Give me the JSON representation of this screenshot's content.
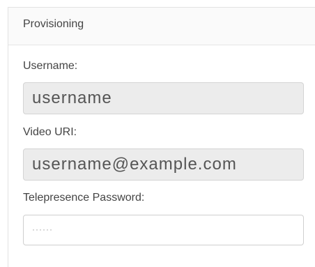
{
  "panel": {
    "title": "Provisioning"
  },
  "fields": {
    "username": {
      "label": "Username:",
      "value": "username"
    },
    "video_uri": {
      "label": "Video URI:",
      "value": "username@example.com"
    },
    "password": {
      "label": "Telepresence Password:",
      "value": "······"
    }
  }
}
